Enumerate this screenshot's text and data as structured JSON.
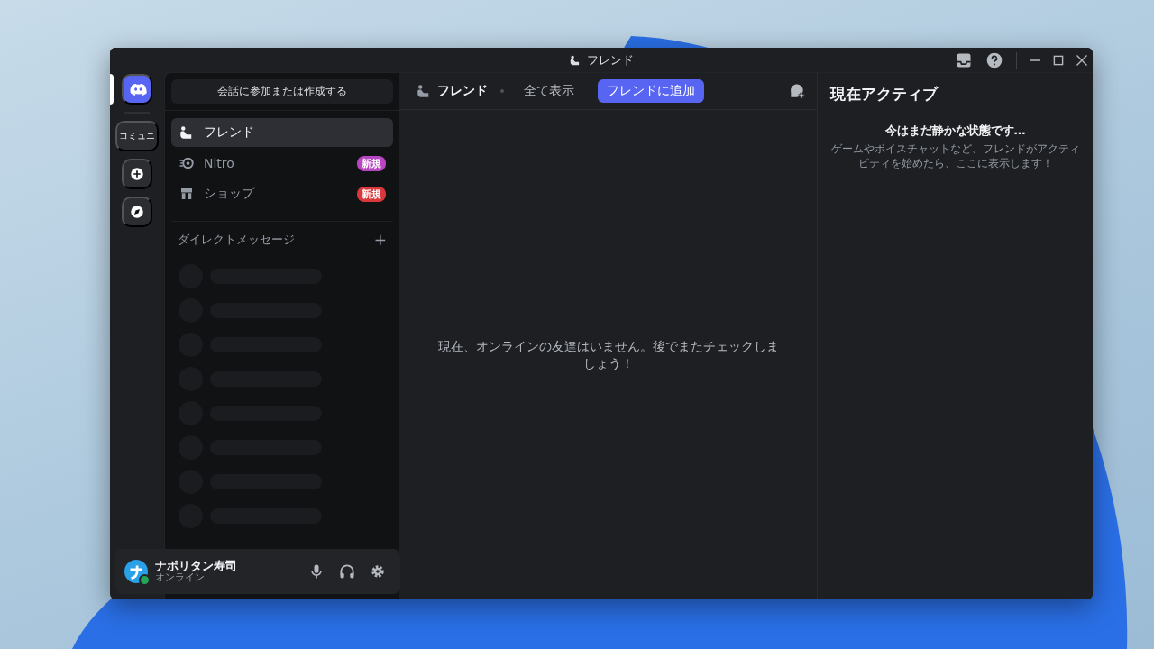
{
  "window": {
    "title": "フレンド"
  },
  "server_rail": [
    {
      "kind": "home",
      "selected": true
    },
    {
      "kind": "server",
      "label": "コミュニ",
      "selected": false
    },
    {
      "kind": "add",
      "selected": false
    },
    {
      "kind": "explore",
      "selected": false
    }
  ],
  "sidebar": {
    "search_button": "会話に参加または作成する",
    "nav": [
      {
        "kind": "friends",
        "label": "フレンド",
        "selected": true
      },
      {
        "kind": "nitro",
        "label": "Nitro",
        "badge": "新規",
        "color": "#b845c1",
        "selected": false
      },
      {
        "kind": "shop",
        "label": "ショップ",
        "badge": "新規",
        "color": "#da373c",
        "selected": false
      }
    ],
    "dm_header": "ダイレクトメッセージ",
    "dm_add": "+"
  },
  "user_panel": {
    "name": "ナポリタン寿司",
    "status": "オンライン",
    "online": true
  },
  "toolbar": {
    "title": "フレンド",
    "tabs": [
      {
        "label": "全て表示",
        "selected": false
      }
    ],
    "add_button": "フレンドに追加"
  },
  "empty_message": "現在、オンラインの友達はいません。後でまたチェックしましょう！",
  "active_now": {
    "title": "現在アクティブ",
    "heading": "今はまだ静かな状態です…",
    "body": "ゲームやボイスチャットなど、フレンドがアクティビティを始めたら、ここに表示します！"
  }
}
